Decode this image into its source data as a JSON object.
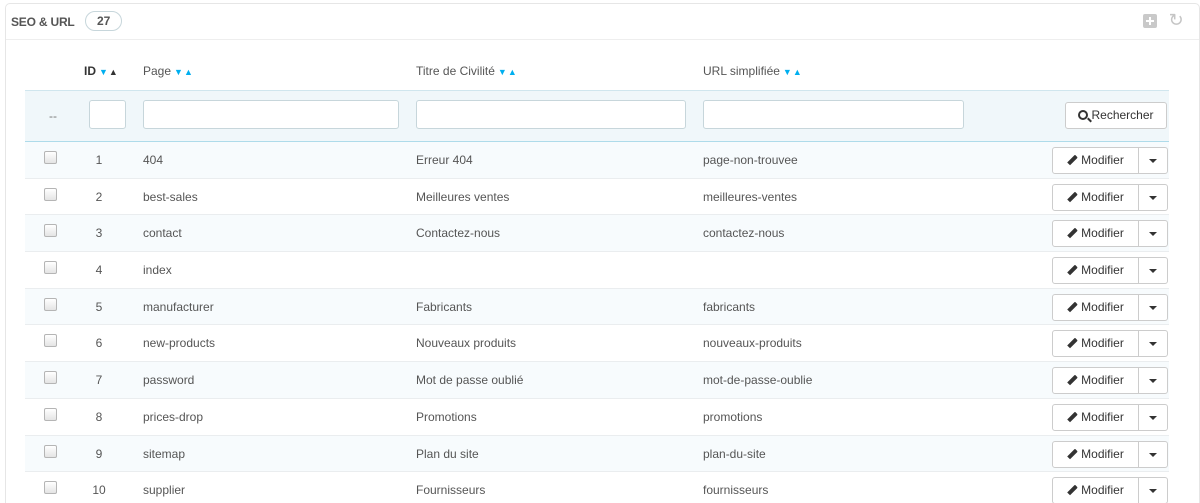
{
  "panel": {
    "title": "SEO & URL",
    "count": "27",
    "add_icon": "plus-square-icon",
    "refresh_icon": "refresh-icon"
  },
  "columns": {
    "id": "ID",
    "page": "Page",
    "title": "Titre de Civilité",
    "url": "URL simplifiée",
    "sort_arrows": "▼▲"
  },
  "filters": {
    "dash": "--",
    "search_label": "Rechercher",
    "id_value": "",
    "page_value": "",
    "title_value": "",
    "url_value": ""
  },
  "actions": {
    "edit_label": "Modifier"
  },
  "rows": [
    {
      "id": "1",
      "page": "404",
      "title": "Erreur 404",
      "url": "page-non-trouvee"
    },
    {
      "id": "2",
      "page": "best-sales",
      "title": "Meilleures ventes",
      "url": "meilleures-ventes"
    },
    {
      "id": "3",
      "page": "contact",
      "title": "Contactez-nous",
      "url": "contactez-nous"
    },
    {
      "id": "4",
      "page": "index",
      "title": "",
      "url": ""
    },
    {
      "id": "5",
      "page": "manufacturer",
      "title": "Fabricants",
      "url": "fabricants"
    },
    {
      "id": "6",
      "page": "new-products",
      "title": "Nouveaux produits",
      "url": "nouveaux-produits"
    },
    {
      "id": "7",
      "page": "password",
      "title": "Mot de passe oublié",
      "url": "mot-de-passe-oublie"
    },
    {
      "id": "8",
      "page": "prices-drop",
      "title": "Promotions",
      "url": "promotions"
    },
    {
      "id": "9",
      "page": "sitemap",
      "title": "Plan du site",
      "url": "plan-du-site"
    },
    {
      "id": "10",
      "page": "supplier",
      "title": "Fournisseurs",
      "url": "fournisseurs"
    }
  ],
  "colors": {
    "accent": "#00aff0",
    "filter_bg": "#f0f7fa"
  }
}
